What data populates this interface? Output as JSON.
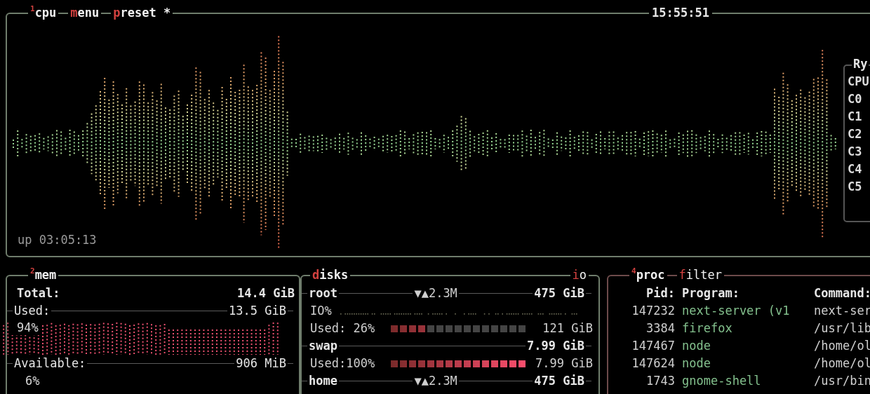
{
  "cpu_box": {
    "number": "1",
    "title": "cpu",
    "menu": {
      "hotkey": "m",
      "rest": "enu"
    },
    "preset": {
      "hotkey": "p",
      "rest": "reset *"
    },
    "clock": "15:55:51",
    "uptime": "up 03:05:13",
    "cores_panel": {
      "title": "Ry",
      "labels": [
        "CPU",
        "C0",
        "C1",
        "C2",
        "C3",
        "C4",
        "C5"
      ]
    }
  },
  "mem_box": {
    "number": "2",
    "title": "mem",
    "rows": [
      {
        "kind": "total",
        "label": "Total:",
        "value": "14.4 GiB"
      },
      {
        "kind": "used",
        "label": "Used:",
        "value": "13.5 GiB",
        "percent": "94%"
      },
      {
        "kind": "available",
        "label": "Available:",
        "value": "906 MiB",
        "percent": "6%"
      }
    ]
  },
  "disks_box": {
    "title": {
      "hotkey": "d",
      "rest": "isks"
    },
    "io": {
      "hotkey": "i",
      "rest": "o"
    },
    "rows": [
      {
        "kind": "disk",
        "name": "root",
        "io": "▼▲2.3M",
        "size": "475 GiB"
      },
      {
        "kind": "io",
        "label": "IO%"
      },
      {
        "kind": "meter",
        "label": "Used: 26%",
        "level": 0.26,
        "value": "121 GiB"
      },
      {
        "kind": "disk",
        "name": "swap",
        "size": "7.99 GiB"
      },
      {
        "kind": "meter",
        "label": "Used:100%",
        "level": 1,
        "value": "7.99 GiB"
      },
      {
        "kind": "disk",
        "name": "home",
        "io": "▼▲2.3M",
        "size": "475 GiB"
      }
    ]
  },
  "proc_box": {
    "number": "4",
    "title": "proc",
    "filter": {
      "hotkey": "f",
      "rest": "ilter"
    },
    "columns": [
      "Pid:",
      "Program:",
      "Command:"
    ],
    "rows": [
      {
        "pid": "147232",
        "program": "next-server (v1",
        "command": "next-ser"
      },
      {
        "pid": "3384",
        "program": "firefox",
        "command": "/usr/lib"
      },
      {
        "pid": "147467",
        "program": "node",
        "command": "/home/ol"
      },
      {
        "pid": "147624",
        "program": "node",
        "command": "/home/ol"
      },
      {
        "pid": "1743",
        "program": "gnome-shell",
        "command": "/usr/bin"
      }
    ]
  }
}
